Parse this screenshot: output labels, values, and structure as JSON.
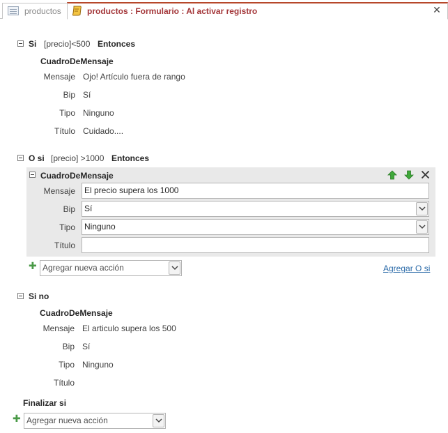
{
  "tabs": {
    "tab1_label": "productos",
    "tab2_label": "productos : Formulario : Al activar registro"
  },
  "if1": {
    "keyword": "Si",
    "condition": "[precio]<500",
    "then": "Entonces",
    "action": "CuadroDeMensaje",
    "fields": [
      {
        "label": "Mensaje",
        "value": "Ojo! Artículo fuera de rango"
      },
      {
        "label": "Bip",
        "value": "Sí"
      },
      {
        "label": "Tipo",
        "value": "Ninguno"
      },
      {
        "label": "Título",
        "value": "Cuidado...."
      }
    ]
  },
  "elseif": {
    "keyword": "O si",
    "condition": "[precio] >1000",
    "then": "Entonces",
    "action": "CuadroDeMensaje",
    "fields": [
      {
        "label": "Mensaje",
        "value": "El precio supera los 1000"
      },
      {
        "label": "Bip",
        "value": "Sí"
      },
      {
        "label": "Tipo",
        "value": "Ninguno"
      },
      {
        "label": "Título",
        "value": ""
      }
    ],
    "add_action_placeholder": "Agregar nueva acción",
    "add_elseif_link": "Agregar O si"
  },
  "else": {
    "keyword": "Si no",
    "action": "CuadroDeMensaje",
    "fields": [
      {
        "label": "Mensaje",
        "value": "El articulo supera los 500"
      },
      {
        "label": "Bip",
        "value": "Sí"
      },
      {
        "label": "Tipo",
        "value": "Ninguno"
      },
      {
        "label": "Título",
        "value": ""
      }
    ]
  },
  "end_if": "Finalizar si",
  "bottom_add_action": "Agregar nueva acción",
  "colors": {
    "active_tab_text": "#a4373a",
    "active_tab_top": "#b7472a",
    "link": "#2a6aa8",
    "plus": "#4a9a47",
    "block_bg": "#e9e9e9"
  },
  "icons": [
    "table-icon",
    "macro-icon",
    "close-icon",
    "collapse-icon",
    "move-up-icon",
    "move-down-icon",
    "delete-icon",
    "plus-icon",
    "dropdown-icon"
  ]
}
